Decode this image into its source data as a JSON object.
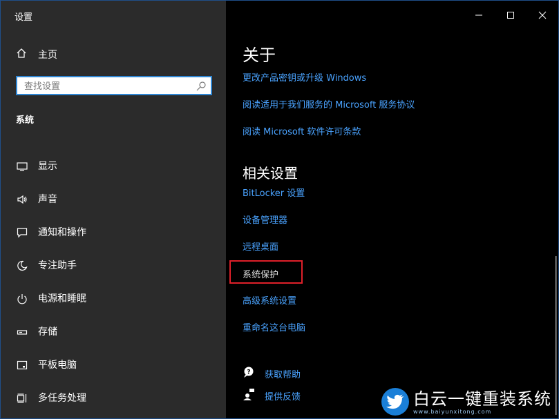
{
  "window": {
    "title": "设置"
  },
  "sidebar": {
    "home_label": "主页",
    "search_placeholder": "查找设置",
    "section_label": "系统",
    "items": [
      {
        "label": "显示",
        "icon": "monitor-icon"
      },
      {
        "label": "声音",
        "icon": "speaker-icon"
      },
      {
        "label": "通知和操作",
        "icon": "notification-icon"
      },
      {
        "label": "专注助手",
        "icon": "moon-icon"
      },
      {
        "label": "电源和睡眠",
        "icon": "power-icon"
      },
      {
        "label": "存储",
        "icon": "storage-icon"
      },
      {
        "label": "平板电脑",
        "icon": "tablet-icon"
      },
      {
        "label": "多任务处理",
        "icon": "multitask-icon"
      }
    ]
  },
  "main": {
    "about_heading": "关于",
    "about_links": [
      "更改产品密钥或升级 Windows",
      "阅读适用于我们服务的 Microsoft 服务协议",
      "阅读 Microsoft 软件许可条款"
    ],
    "related_heading": "相关设置",
    "related_links": [
      "BitLocker 设置",
      "设备管理器",
      "远程桌面",
      "系统保护",
      "高级系统设置",
      "重命名这台电脑"
    ],
    "help_links": [
      {
        "label": "获取帮助",
        "icon": "help-chat-icon"
      },
      {
        "label": "提供反馈",
        "icon": "feedback-icon"
      }
    ]
  },
  "watermark": {
    "text": "白云一键重装系统",
    "url": "www.baiyunxitong.com"
  },
  "colors": {
    "sidebar_bg": "#2b2b2b",
    "main_bg": "#000000",
    "link": "#4aa3ff",
    "highlight_box": "#e0202a",
    "search_border": "#2e86d4"
  }
}
